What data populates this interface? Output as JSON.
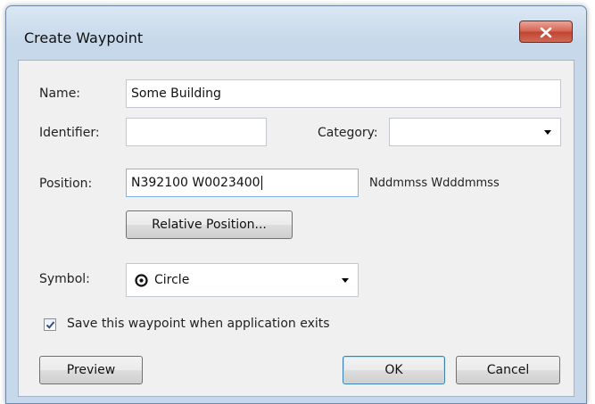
{
  "window": {
    "title": "Create Waypoint"
  },
  "form": {
    "name_label": "Name:",
    "name_value": "Some Building",
    "identifier_label": "Identifier:",
    "identifier_value": "",
    "category_label": "Category:",
    "category_value": "",
    "position_label": "Position:",
    "position_value": "N392100 W0023400",
    "position_format_hint": "Nddmmss Wdddmmss",
    "relative_position_button": "Relative Position...",
    "symbol_label": "Symbol:",
    "symbol_value": "Circle",
    "symbol_icon": "circle-target-icon",
    "save_checkbox_label": "Save this waypoint when application exits",
    "save_checkbox_checked": true
  },
  "buttons": {
    "preview": "Preview",
    "ok": "OK",
    "cancel": "Cancel"
  },
  "colors": {
    "title_bar": "#c7d8ea",
    "close_button": "#c14432",
    "default_button_border": "#3c7fb1",
    "dialog_background": "#f0f0f0"
  }
}
